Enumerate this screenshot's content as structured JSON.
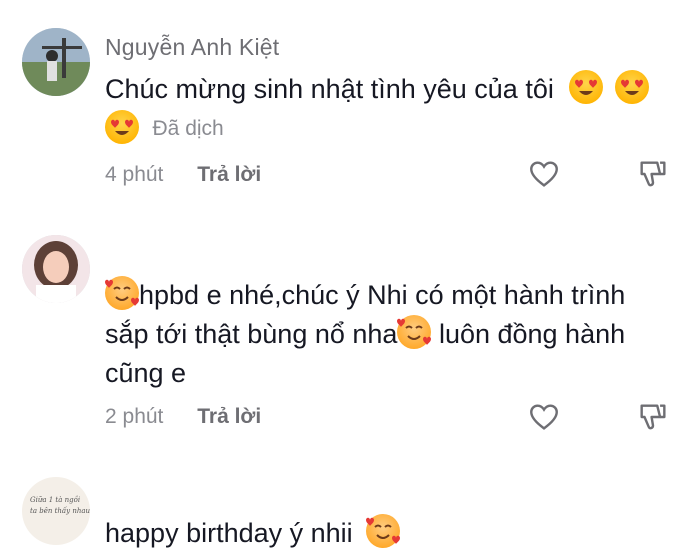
{
  "comments": [
    {
      "username": "Nguyễn Anh Kiệt",
      "text_line1": "Chúc mừng sinh nhật tình yêu của tôi",
      "translated_label": "Đã dịch",
      "time": "4 phút",
      "reply_label": "Trả lời"
    },
    {
      "text_line1": "hpbd e nhé,chúc ý Nhi có một hành trình",
      "text_line2a": "sắp tới thật bùng nổ nha",
      "text_line2b": " luôn đồng hành",
      "text_line3": "cũng e",
      "time": "2 phút",
      "reply_label": "Trả lời"
    },
    {
      "text_line1": "happy birthday ý nhii",
      "avatar_note_line1": "Giữa 1 tà ngồi",
      "avatar_note_line2": "ta bên thấy nhau"
    }
  ],
  "icons": {
    "like": "heart-outline-icon",
    "dislike": "thumbs-down-icon",
    "emoji1": "smiling-face-with-heart-eyes",
    "emoji2": "smiling-face-with-hearts"
  }
}
